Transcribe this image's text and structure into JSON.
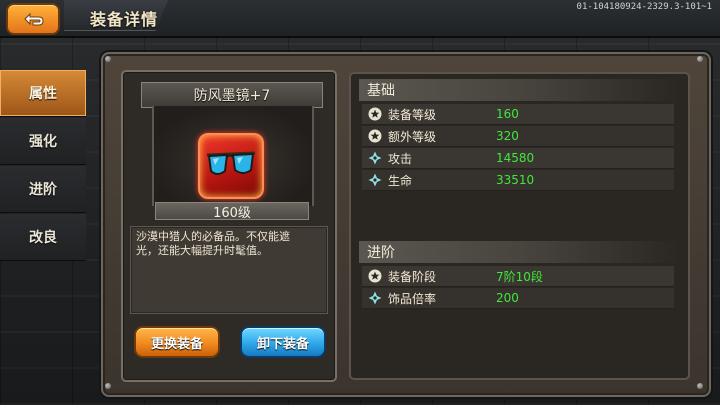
{
  "header": {
    "title": "装备详情",
    "build_id": "01-104180924-2329.3-101~1"
  },
  "sidebar": {
    "items": [
      {
        "label": "属性",
        "active": true
      },
      {
        "label": "强化",
        "active": false
      },
      {
        "label": "进阶",
        "active": false
      },
      {
        "label": "改良",
        "active": false
      }
    ]
  },
  "item": {
    "name": "防风墨镜+7",
    "level": "160级",
    "icon": "sunglasses-icon",
    "description": "沙漠中猎人的必备品。不仅能遮光，还能大幅提升时髦值。"
  },
  "buttons": {
    "replace": "更换装备",
    "unequip": "卸下装备"
  },
  "sections": {
    "basic": {
      "title": "基础",
      "rows": [
        {
          "label": "装备等级",
          "value": "160",
          "icon": "star-icon"
        },
        {
          "label": "额外等级",
          "value": "320",
          "icon": "star-icon"
        },
        {
          "label": "攻击",
          "value": "14580",
          "icon": "diamond-icon"
        },
        {
          "label": "生命",
          "value": "33510",
          "icon": "diamond-icon"
        }
      ]
    },
    "advanced": {
      "title": "进阶",
      "rows": [
        {
          "label": "装备阶段",
          "value": "7阶10段",
          "icon": "star-icon"
        },
        {
          "label": "饰品倍率",
          "value": "200",
          "icon": "diamond-icon"
        }
      ]
    }
  },
  "colors": {
    "accent_orange": "#f08a1f",
    "accent_blue": "#2fa8ea",
    "value_green": "#41e83b"
  }
}
